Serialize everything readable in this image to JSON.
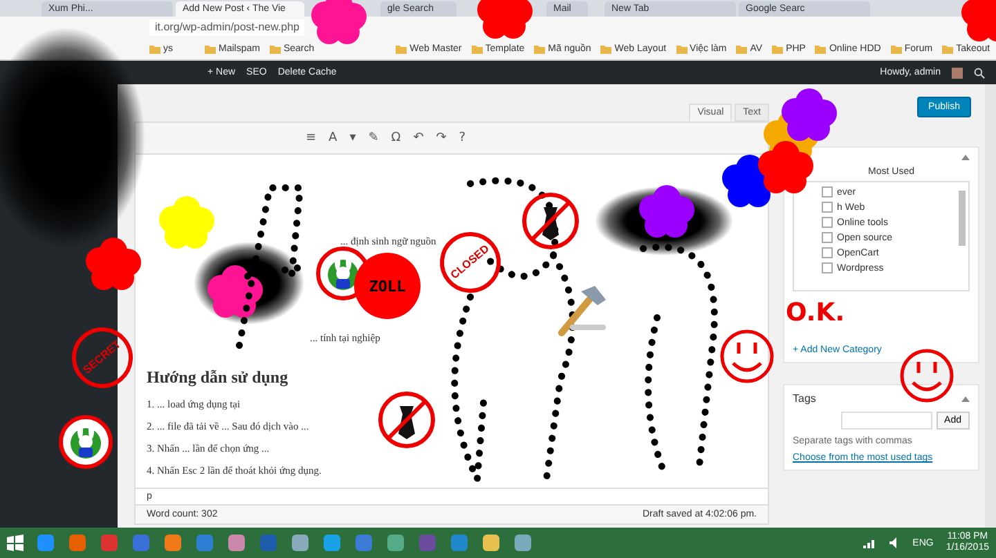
{
  "browser": {
    "tabs": [
      {
        "label": "Xum Phi...",
        "selected": false
      },
      {
        "label": "Add New Post ‹ The Vie",
        "selected": true
      },
      {
        "label": "gle Search",
        "selected": false
      },
      {
        "label": "Mail",
        "selected": false
      },
      {
        "label": "New Tab",
        "selected": false
      },
      {
        "label": "Google Searc",
        "selected": false
      }
    ],
    "address": "it.org/wp-admin/post-new.php",
    "bookmarks": [
      "ys",
      "Mailspam",
      "Search",
      "Web Master",
      "Template",
      "Mã nguồn",
      "Web Layout",
      "Việc làm",
      "AV",
      "PHP",
      "Online HDD",
      "Forum",
      "Takeout"
    ]
  },
  "admin_bar": {
    "items": [
      "+ New",
      "SEO",
      "Delete Cache"
    ],
    "greeting": "Howdy, admin"
  },
  "editor": {
    "tabs": [
      {
        "label": "Visual",
        "selected": true
      },
      {
        "label": "Text",
        "selected": false
      }
    ],
    "toolbar": [
      "≡",
      "A",
      "▾",
      "✎",
      "Ω",
      "↶",
      "↷",
      "?"
    ],
    "content": [
      {
        "kind": "text",
        "text": "... định sinh ngữ nguồn"
      },
      {
        "kind": "text",
        "text": "... tính tại nghiệp"
      },
      {
        "kind": "heading",
        "text": "Hướng dẫn sử dụng"
      },
      {
        "kind": "text",
        "text": "1. ... load ứng dụng tại"
      },
      {
        "kind": "text",
        "text": "2. ... file đã tải về ... Sau đó dịch vào ..."
      },
      {
        "kind": "text",
        "text": "3. Nhấn ... lần để chọn ứng ..."
      },
      {
        "kind": "text",
        "text": "4. Nhấn Esc 2 lần để thoát khỏi ứng dụng."
      }
    ],
    "path": "p",
    "word_count": "Word count: 302",
    "draft_status": "Draft saved at 4:02:06 pm."
  },
  "publish": {
    "button": "Publish"
  },
  "categories": {
    "tab": "Most Used",
    "items": [
      {
        "label": "ever",
        "checked": false
      },
      {
        "label": "h Web",
        "checked": false
      },
      {
        "label": "Online tools",
        "checked": false
      },
      {
        "label": "Open source",
        "checked": false
      },
      {
        "label": "OpenCart",
        "checked": false
      },
      {
        "label": "Wordpress",
        "checked": false
      }
    ],
    "add_link": "+ Add New Category"
  },
  "tags": {
    "title": "Tags",
    "button": "Add",
    "hint": "Separate tags with commas",
    "link": "Choose from the most used tags"
  },
  "taskbar": {
    "tray": "ENG",
    "time": "11:08 PM",
    "date": "1/16/2015"
  },
  "stickers": [
    {
      "kind": "spray"
    },
    {
      "kind": "spray"
    },
    {
      "kind": "spray"
    },
    {
      "kind": "blob",
      "color": "#ff1493"
    },
    {
      "kind": "blob",
      "color": "#ff0000"
    },
    {
      "kind": "blob",
      "color": "#ffff00"
    },
    {
      "kind": "blob",
      "color": "#ff0000"
    },
    {
      "kind": "blob",
      "color": "#ff1493"
    },
    {
      "kind": "blob",
      "color": "#9b00ff"
    },
    {
      "kind": "blob",
      "color": "#0000ff"
    },
    {
      "kind": "blob",
      "color": "#f5a800"
    },
    {
      "kind": "blob",
      "color": "#9b00ff"
    },
    {
      "kind": "blob",
      "color": "#ff0000"
    },
    {
      "kind": "blob",
      "color": "#ff0000"
    },
    {
      "kind": "doodle"
    },
    {
      "kind": "doodle"
    },
    {
      "kind": "doodle"
    },
    {
      "kind": "stamp",
      "text": "SECRET"
    },
    {
      "kind": "stamp",
      "text": "CLOSED"
    },
    {
      "kind": "bunny"
    },
    {
      "kind": "sign",
      "text": "ZOLL"
    },
    {
      "kind": "bunny"
    },
    {
      "kind": "no-sign"
    },
    {
      "kind": "no-sign"
    },
    {
      "kind": "hammer"
    },
    {
      "kind": "scrawl",
      "text": "O.K."
    },
    {
      "kind": "smiley"
    },
    {
      "kind": "smiley"
    }
  ]
}
